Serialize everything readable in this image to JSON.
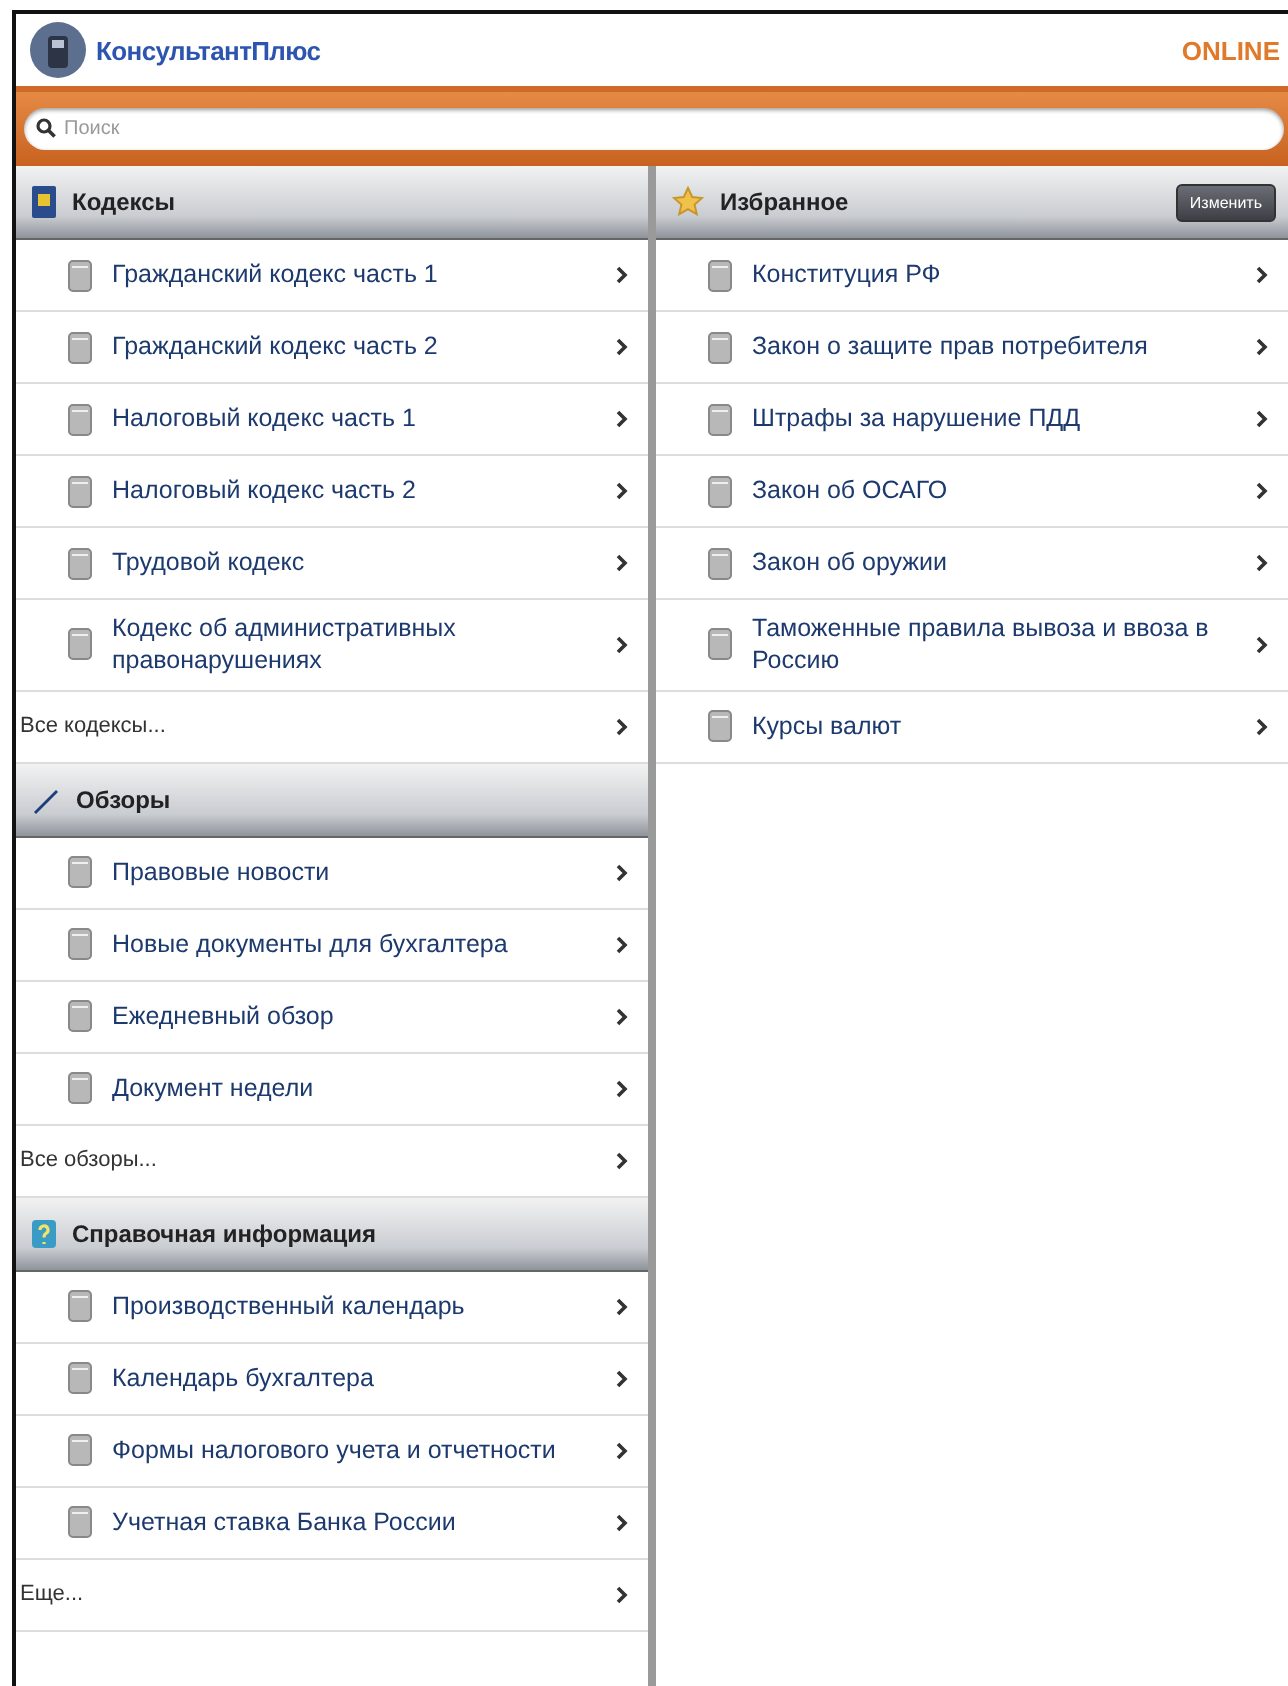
{
  "header": {
    "logo_text": "КонсультантПлюс",
    "status": "ONLINE"
  },
  "search": {
    "placeholder": "Поиск"
  },
  "left_sections": [
    {
      "kind": "codes",
      "title": "Кодексы",
      "items": [
        {
          "label": "Гражданский кодекс часть 1"
        },
        {
          "label": "Гражданский кодекс часть 2"
        },
        {
          "label": "Налоговый кодекс часть 1"
        },
        {
          "label": "Налоговый кодекс часть 2"
        },
        {
          "label": "Трудовой кодекс"
        },
        {
          "label": "Кодекс об административных правонарушениях"
        }
      ],
      "more": "Все кодексы..."
    },
    {
      "kind": "reviews",
      "title": "Обзоры",
      "items": [
        {
          "label": "Правовые новости"
        },
        {
          "label": "Новые документы для бухгалтера"
        },
        {
          "label": "Ежедневный обзор"
        },
        {
          "label": "Документ недели"
        }
      ],
      "more": "Все обзоры..."
    },
    {
      "kind": "reference",
      "title": "Справочная информация",
      "items": [
        {
          "label": "Производственный календарь"
        },
        {
          "label": "Календарь бухгалтера"
        },
        {
          "label": "Формы налогового учета и отчетности"
        },
        {
          "label": "Учетная ставка Банка России"
        }
      ],
      "more": "Еще..."
    }
  ],
  "favorites": {
    "title": "Избранное",
    "edit_button": "Изменить",
    "items": [
      {
        "label": "Конституция РФ"
      },
      {
        "label": "Закон о защите прав потребителя"
      },
      {
        "label": "Штрафы за нарушение ПДД"
      },
      {
        "label": "Закон об ОСАГО"
      },
      {
        "label": "Закон об оружии"
      },
      {
        "label": "Таможенные правила вывоза и ввоза в Россию"
      },
      {
        "label": "Курсы валют"
      }
    ]
  }
}
